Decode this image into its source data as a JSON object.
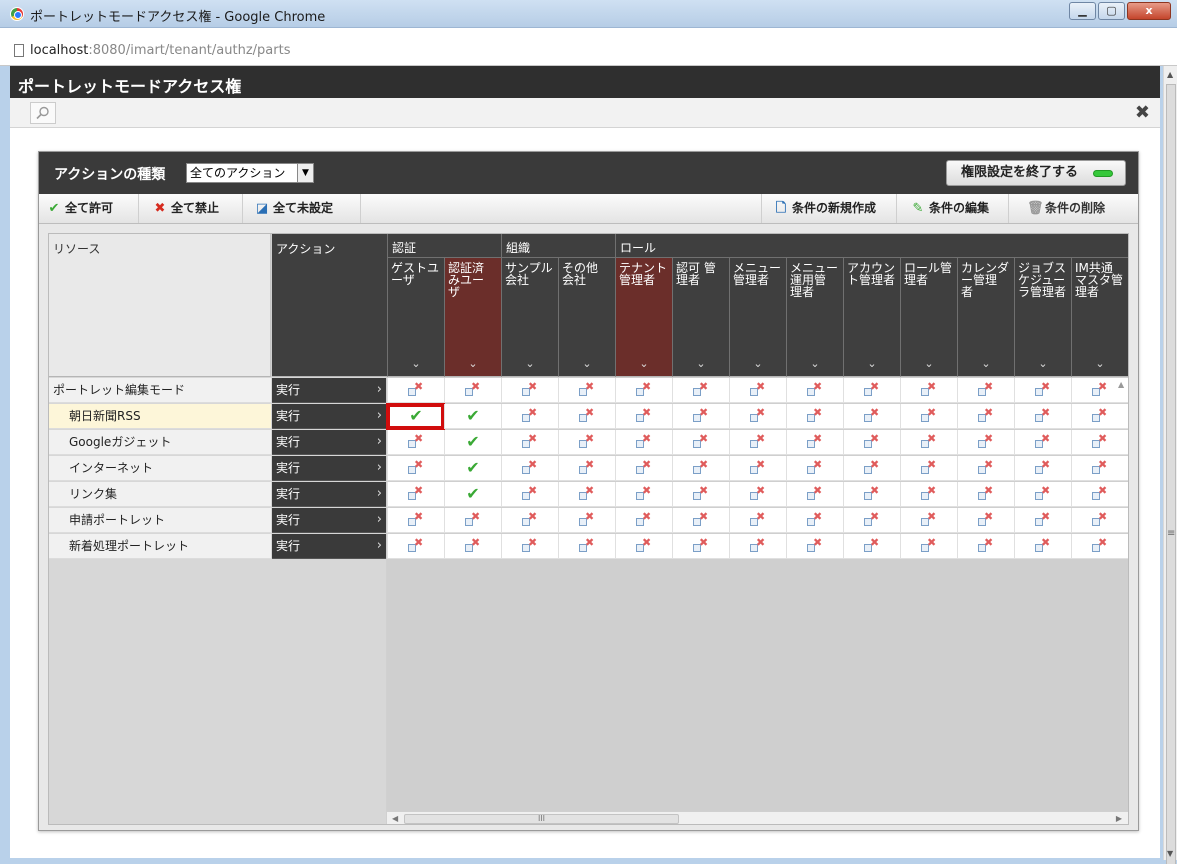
{
  "window": {
    "title": "ポートレットモードアクセス権 - Google Chrome",
    "url_host": "localhost",
    "url_rest": ":8080/imart/tenant/authz/parts",
    "close_glyph": "x"
  },
  "app": {
    "title": "ポートレットモードアクセス権"
  },
  "dialog": {
    "action_type_label": "アクションの種類",
    "action_select_value": "全てのアクション",
    "end_button": "権限設定を終了する"
  },
  "toolbar": {
    "allow_all": "全て許可",
    "deny_all": "全て禁止",
    "unset_all": "全て未設定",
    "new_condition": "条件の新規作成",
    "edit_condition": "条件の編集",
    "delete_condition": "条件の削除"
  },
  "grid": {
    "resource_header": "リソース",
    "action_header": "アクション",
    "groups": [
      "認証",
      "組織",
      "ロール"
    ],
    "columns": [
      "ゲストユーザ",
      "認証済みユーザ",
      "サンプル会社",
      "その他会社",
      "テナント管理者",
      "認可 管理者",
      "メニュー管理者",
      "メニュー運用管理者",
      "アカウント管理者",
      "ロール管理者",
      "カレンダー管理者",
      "ジョブスケジューラ管理者",
      "IM共通マスタ管理者"
    ],
    "columns_display": [
      "ゲストユ\nーザ",
      "認証済\nみユー\nザ",
      "サンプル\n会社",
      "その他\n会社",
      "テナント\n管理者",
      "認可 管\n理者",
      "メニュー\n管理者",
      "メニュー\n運用管\n理者",
      "アカウン\nト管理者",
      "ロール管\n理者",
      "カレンダ\nー管理\n者",
      "ジョブス\nケジュー\nラ管理者",
      "IM共通\nマスタ管\n理者"
    ],
    "chevron": "⌄",
    "rows": [
      {
        "name": "ポートレット編集モード",
        "action": "実行",
        "allowed": []
      },
      {
        "name": "朝日新聞RSS",
        "action": "実行",
        "allowed": [
          0,
          1
        ]
      },
      {
        "name": "Googleガジェット",
        "action": "実行",
        "allowed": [
          1
        ]
      },
      {
        "name": "インターネット",
        "action": "実行",
        "allowed": [
          1
        ]
      },
      {
        "name": "リンク集",
        "action": "実行",
        "allowed": [
          1
        ]
      },
      {
        "name": "申請ポートレット",
        "action": "実行",
        "allowed": []
      },
      {
        "name": "新着処理ポートレット",
        "action": "実行",
        "allowed": []
      }
    ],
    "scroll_grip": "III"
  }
}
